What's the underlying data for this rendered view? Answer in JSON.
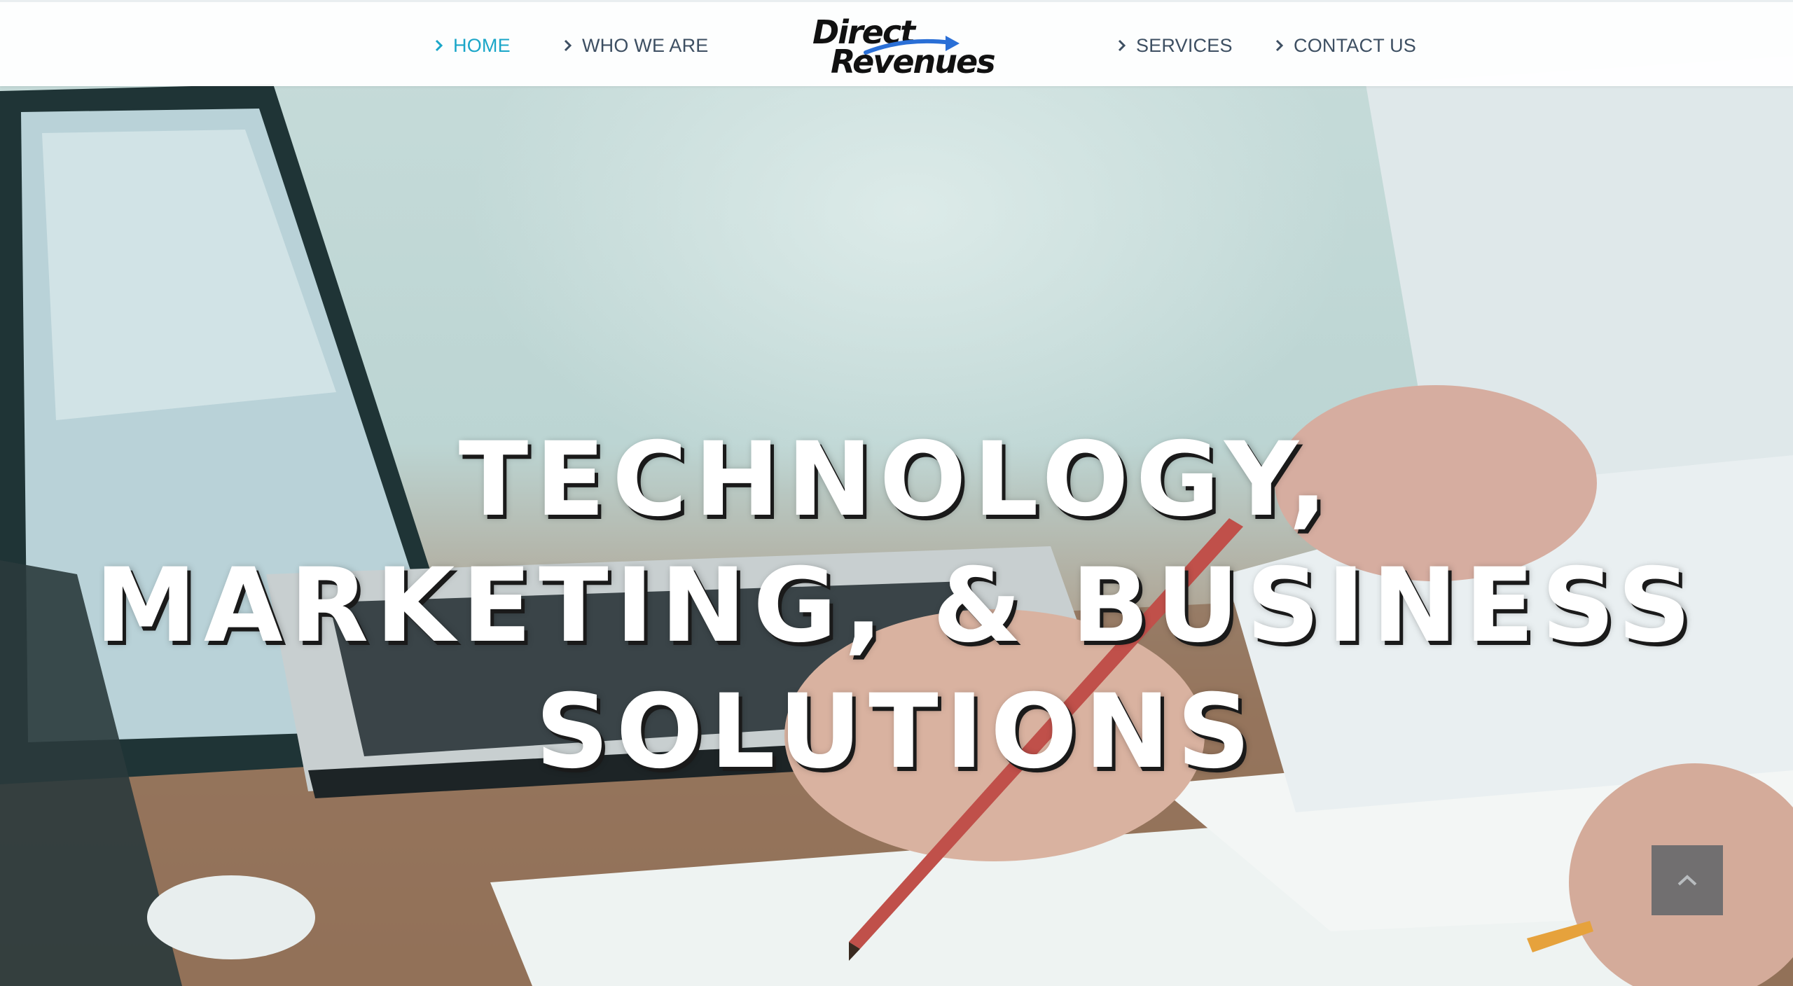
{
  "nav": {
    "items": [
      {
        "label": "HOME",
        "active": true
      },
      {
        "label": "WHO WE ARE",
        "active": false
      },
      {
        "label": "SERVICES",
        "active": false
      },
      {
        "label": "CONTACT US",
        "active": false
      }
    ],
    "logo": {
      "line1": "Direct",
      "line2": "Revenues"
    },
    "active_color": "#1aa6c8",
    "text_color": "#3d4f62",
    "chevron_icon": "chevron-right-icon"
  },
  "hero": {
    "headline_lines": [
      "TECHNOLOGY,",
      "MARKETING, & BUSINESS",
      "SOLUTIONS"
    ]
  },
  "scroll_top": {
    "icon": "chevron-up-icon"
  }
}
